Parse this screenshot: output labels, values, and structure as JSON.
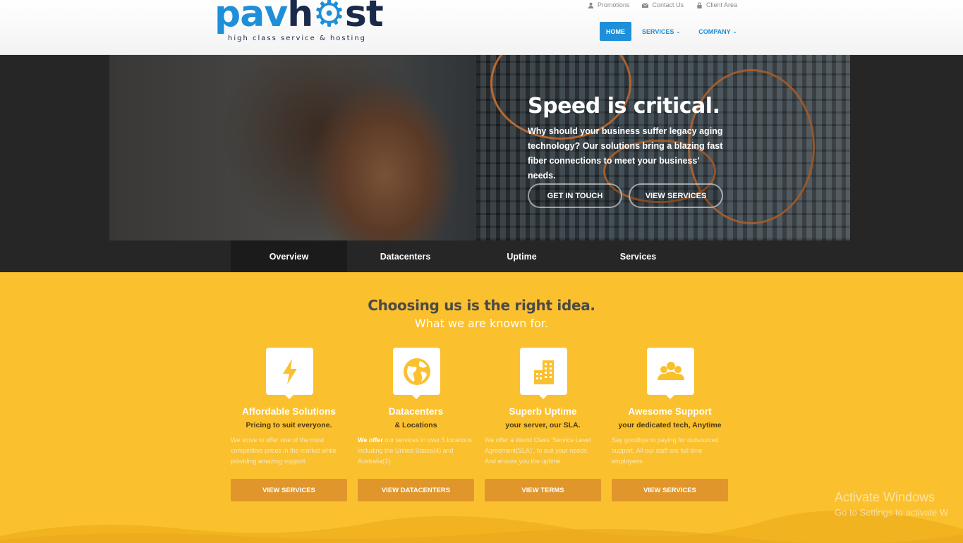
{
  "colors": {
    "brand_blue": "#1e8fd8",
    "brand_navy": "#1b2a4a",
    "accent_yellow": "#fbc02d",
    "button_orange": "#e0962b",
    "dark_band": "#262626"
  },
  "logo": {
    "part1": "pav",
    "part2": "h",
    "part3": "st",
    "tagline": "high class service & hosting"
  },
  "toplinks": [
    {
      "label": "Promotions",
      "icon": "user-icon"
    },
    {
      "label": "Contact Us",
      "icon": "envelope-icon"
    },
    {
      "label": "Client Area",
      "icon": "lock-icon"
    }
  ],
  "nav": {
    "home": "HOME",
    "services": "SERVICES",
    "company": "COMPANY",
    "chevron": "⌄"
  },
  "hero": {
    "title": "Speed is critical.",
    "text": "Why should your business suffer legacy aging technology? Our solutions bring a blazing fast fiber connections to meet your business' needs.",
    "btn_contact": "GET IN TOUCH",
    "btn_services": "VIEW SERVICES"
  },
  "tabs": [
    "Overview",
    "Datacenters",
    "Uptime",
    "Services"
  ],
  "section": {
    "title": "Choosing us is the right idea.",
    "subtitle": "What we are known for."
  },
  "features": [
    {
      "icon": "lightning-icon",
      "title": "Affordable Solutions",
      "sub": "Pricing to suit everyone.",
      "desc_lead": "",
      "desc": "We strive to offer one of the most competitive prices in the market while providing amazing support.",
      "button": "VIEW SERVICES"
    },
    {
      "icon": "globe-icon",
      "title": "Datacenters",
      "sub": "& Locations",
      "desc_lead": "We offer",
      "desc": " our services in over 5 locations including the United States(4) and Australia(1).",
      "button": "VIEW DATACENTERS"
    },
    {
      "icon": "building-icon",
      "title": "Superb Uptime",
      "sub": "your server, our SLA.",
      "desc_lead": "",
      "desc": "We offer a World Class 'Service Level Agreement(SLA)', to suit your needs. And ensure you the uptime.",
      "button": "VIEW TERMS"
    },
    {
      "icon": "team-icon",
      "title": "Awesome Support",
      "sub": "your dedicated tech, Anytime",
      "desc_lead": "",
      "desc": "Say goodbye to paying for outsourced support, All our staff are full time employees.",
      "button": "VIEW SERVICES"
    }
  ],
  "watermark": {
    "line1": "Activate Windows",
    "line2": "Go to Settings to activate W"
  }
}
